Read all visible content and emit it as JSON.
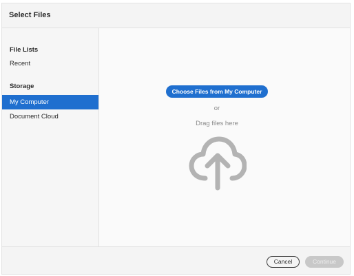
{
  "dialog": {
    "title": "Select Files"
  },
  "sidebar": {
    "file_lists_heading": "File Lists",
    "recent_label": "Recent",
    "storage_heading": "Storage",
    "items": [
      {
        "label": "My Computer",
        "selected": true
      },
      {
        "label": "Document Cloud",
        "selected": false
      }
    ]
  },
  "main": {
    "choose_button_label": "Choose Files from My Computer",
    "or_text": "or",
    "drag_text": "Drag files here",
    "upload_icon": "cloud-upload-icon"
  },
  "footer": {
    "cancel_label": "Cancel",
    "continue_label": "Continue"
  },
  "colors": {
    "accent": "#1f6fcf",
    "disabled": "#c8c8c8",
    "icon_gray": "#b3b3b3"
  }
}
